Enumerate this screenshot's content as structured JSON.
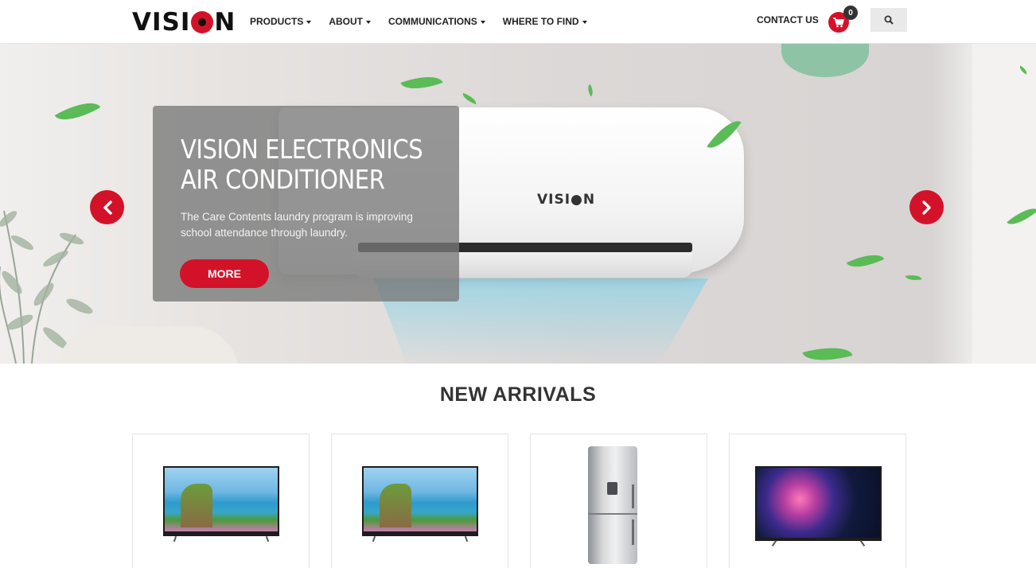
{
  "header": {
    "logo_text": "VISION",
    "nav": [
      {
        "label": "PRODUCTS"
      },
      {
        "label": "ABOUT"
      },
      {
        "label": "COMMUNICATIONS"
      },
      {
        "label": "WHERE TO FIND"
      }
    ],
    "contact_label": "CONTACT US",
    "cart_count": "0",
    "icons": {
      "cart": "shopping-cart-icon",
      "search": "search-icon"
    }
  },
  "hero": {
    "title_line1": "VISION ELECTRONICS",
    "title_line2": "AIR CONDITIONER",
    "text": "The Care Contents laundry program is improving school attendance through laundry.",
    "button_label": "MORE",
    "product_brand": "VISI●N",
    "icons": {
      "prev": "chevron-left-icon",
      "next": "chevron-right-icon"
    }
  },
  "new_arrivals": {
    "title": "NEW ARRIVALS",
    "products": [
      {
        "image": "tv-landscape"
      },
      {
        "image": "tv-landscape"
      },
      {
        "image": "fridge-silver"
      },
      {
        "image": "tv-galaxy"
      }
    ]
  },
  "colors": {
    "brand_red": "#d3122a",
    "caption_bg": "rgba(120,120,120,0.78)"
  }
}
